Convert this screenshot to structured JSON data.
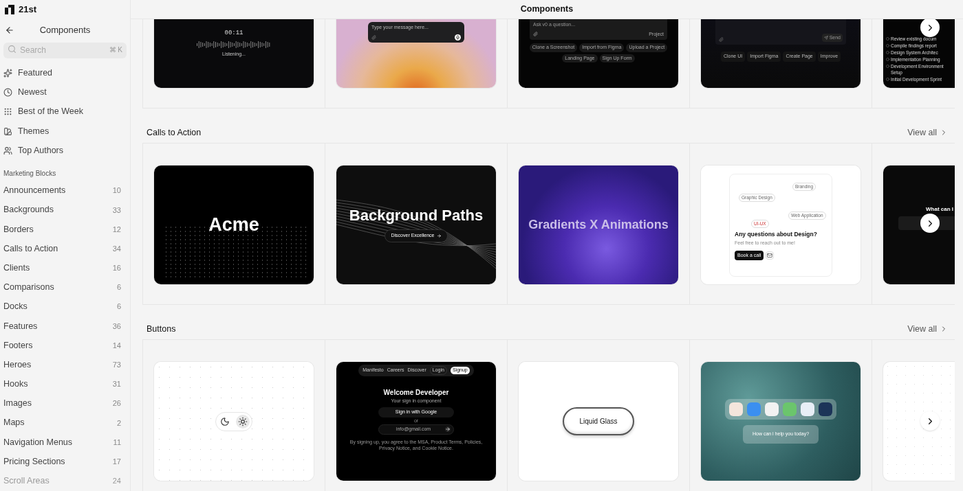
{
  "brand": "21st",
  "header": {
    "title": "Components"
  },
  "sidebar": {
    "back_label": "Components",
    "search": {
      "placeholder": "Search",
      "shortcut": "⌘ K"
    },
    "nav": [
      {
        "label": "Featured"
      },
      {
        "label": "Newest"
      },
      {
        "label": "Best of the Week"
      },
      {
        "label": "Themes"
      },
      {
        "label": "Top Authors"
      }
    ],
    "group": {
      "title": "Marketing Blocks",
      "items": [
        {
          "label": "Announcements",
          "count": "10",
          "dimmed": false
        },
        {
          "label": "Backgrounds",
          "count": "33",
          "dimmed": false
        },
        {
          "label": "Borders",
          "count": "12",
          "dimmed": false
        },
        {
          "label": "Calls to Action",
          "count": "34",
          "dimmed": false
        },
        {
          "label": "Clients",
          "count": "16",
          "dimmed": false
        },
        {
          "label": "Comparisons",
          "count": "6",
          "dimmed": false
        },
        {
          "label": "Docks",
          "count": "6",
          "dimmed": false
        },
        {
          "label": "Features",
          "count": "36",
          "dimmed": false
        },
        {
          "label": "Footers",
          "count": "14",
          "dimmed": false
        },
        {
          "label": "Heroes",
          "count": "73",
          "dimmed": false
        },
        {
          "label": "Hooks",
          "count": "31",
          "dimmed": false
        },
        {
          "label": "Images",
          "count": "26",
          "dimmed": false
        },
        {
          "label": "Maps",
          "count": "2",
          "dimmed": false
        },
        {
          "label": "Navigation Menus",
          "count": "11",
          "dimmed": false
        },
        {
          "label": "Pricing Sections",
          "count": "17",
          "dimmed": false
        },
        {
          "label": "Scroll Areas",
          "count": "24",
          "dimmed": true
        }
      ]
    }
  },
  "sections": [
    {
      "cut": true,
      "cards": [
        {
          "kind": "voice",
          "time": "00:11",
          "status": "Listening..."
        },
        {
          "kind": "sunset-chat",
          "placeholder": "Type your message here..."
        },
        {
          "kind": "v0-chat",
          "placeholder": "Ask v0 a question...",
          "project": "Project",
          "chips": [
            "Clone a Screenshot",
            "Import from Figma",
            "Upload a Project",
            "Landing Page",
            "Sign Up Form"
          ]
        },
        {
          "kind": "ai-prompt",
          "chips": [
            "Clone UI",
            "Import Figma",
            "Create Page",
            "Improve"
          ],
          "send": "Send"
        },
        {
          "kind": "task-list",
          "items": [
            "Review existing docum",
            "Compile findings report",
            "Design System Architec",
            "Implementation Planning",
            "Development Environment Setup",
            "Initial Development Sprint"
          ]
        }
      ]
    },
    {
      "title": "Calls to Action",
      "view_all": "View all",
      "cut": false,
      "cards": [
        {
          "kind": "acme",
          "title": "Acme"
        },
        {
          "kind": "paths",
          "title": "Background Paths",
          "button": "Discover Excellence"
        },
        {
          "kind": "gradient",
          "title": "Gradients X Animations"
        },
        {
          "kind": "contact",
          "tags": [
            "Branding",
            "Graphic Design",
            "Web Application",
            "UI-UX"
          ],
          "title": "Any questions about Design?",
          "subtitle": "Feel free to reach out to me!",
          "button": "Book a call"
        },
        {
          "kind": "dark-question",
          "title": "What can I"
        }
      ]
    },
    {
      "title": "Buttons",
      "view_all": "View all",
      "cut": false,
      "cards": [
        {
          "kind": "theme-toggle",
          "modes": [
            {
              "selected": false
            },
            {
              "selected": true
            }
          ]
        },
        {
          "kind": "signin",
          "nav": [
            "Manifesto",
            "Careers",
            "Discover"
          ],
          "login": "Login",
          "signup": "Signup",
          "title": "Welcome Developer",
          "subtitle": "Your sign in component",
          "google": "Sign in with Google",
          "or": "or",
          "email": "info@gmail.com",
          "legal": "By signing up, you agree to the MSA, Product Terms, Policies, Privacy Notice, and Cookie Notice."
        },
        {
          "kind": "liquid",
          "label": "Liquid Glass"
        },
        {
          "kind": "water-dock",
          "prompt": "How can i help you today?"
        },
        {
          "kind": "dots-purple"
        }
      ]
    }
  ]
}
